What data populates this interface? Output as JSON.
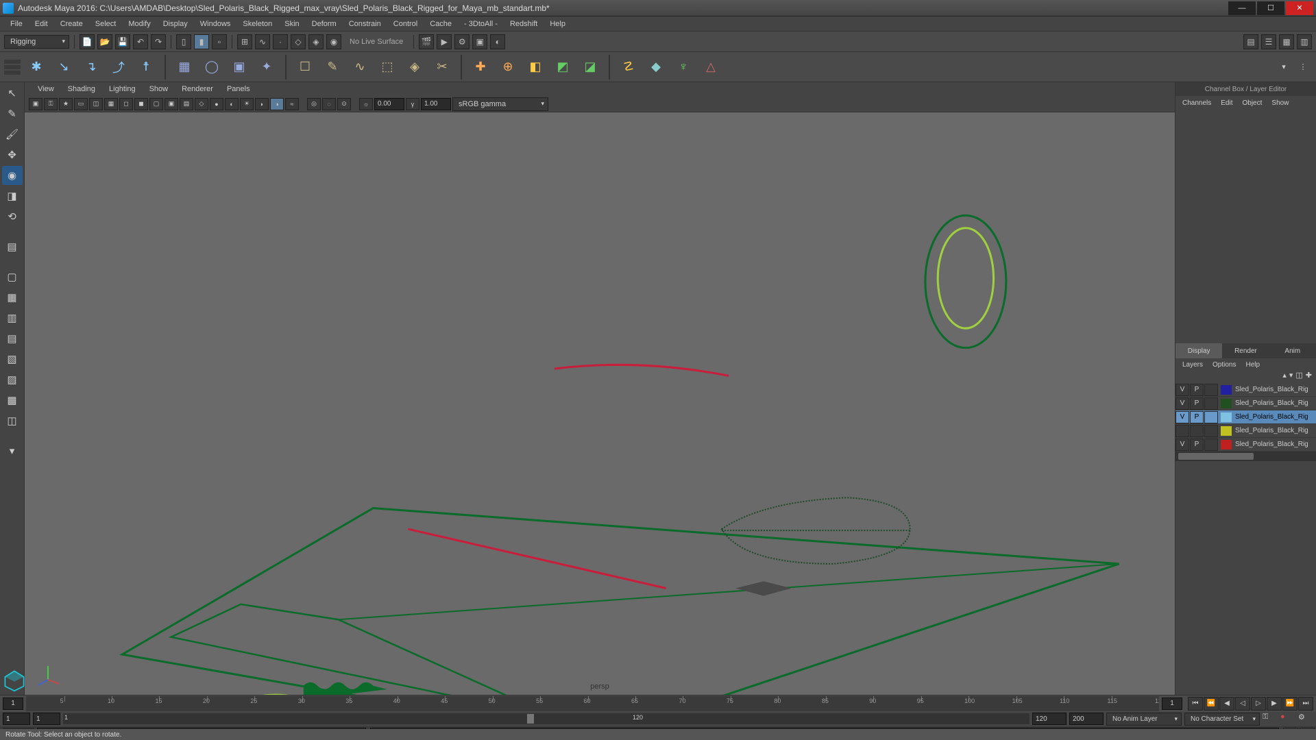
{
  "title": "Autodesk Maya 2016: C:\\Users\\AMDAB\\Desktop\\Sled_Polaris_Black_Rigged_max_vray\\Sled_Polaris_Black_Rigged_for_Maya_mb_standart.mb*",
  "menubar": [
    "File",
    "Edit",
    "Create",
    "Select",
    "Modify",
    "Display",
    "Windows",
    "Skeleton",
    "Skin",
    "Deform",
    "Constrain",
    "Control",
    "Cache",
    "- 3DtoAll -",
    "Redshift",
    "Help"
  ],
  "workspace": "Rigging",
  "no_live_surface": "No Live Surface",
  "viewport": {
    "menus": [
      "View",
      "Shading",
      "Lighting",
      "Show",
      "Renderer",
      "Panels"
    ],
    "exposure": "0.00",
    "gamma": "1.00",
    "colorspace": "sRGB gamma",
    "camera": "persp"
  },
  "channelbox": {
    "title": "Channel Box / Layer Editor",
    "menus": [
      "Channels",
      "Edit",
      "Object",
      "Show"
    ],
    "tabs": [
      "Display",
      "Render",
      "Anim"
    ],
    "active_tab": 0,
    "layer_menus": [
      "Layers",
      "Options",
      "Help"
    ],
    "layers": [
      {
        "v": "V",
        "p": "P",
        "color": "#2020a0",
        "name": "Sled_Polaris_Black_Rig",
        "sel": false
      },
      {
        "v": "V",
        "p": "P",
        "color": "#205020",
        "name": "Sled_Polaris_Black_Rig",
        "sel": false
      },
      {
        "v": "V",
        "p": "P",
        "color": "#80c0e0",
        "name": "Sled_Polaris_Black_Rig",
        "sel": true
      },
      {
        "v": "",
        "p": "",
        "color": "#c0c020",
        "name": "Sled_Polaris_Black_Rig",
        "sel": false
      },
      {
        "v": "V",
        "p": "P",
        "color": "#c02020",
        "name": "Sled_Polaris_Black_Rig",
        "sel": false
      }
    ]
  },
  "time": {
    "current": "1",
    "start": "1",
    "end": "120",
    "range_start": "1",
    "range_end": "120",
    "anim_start": "1",
    "anim_end": "200",
    "anim_layer": "No Anim Layer",
    "char_set": "No Character Set"
  },
  "cmd": {
    "type": "MEL"
  },
  "helpline": "Rotate Tool: Select an object to rotate."
}
